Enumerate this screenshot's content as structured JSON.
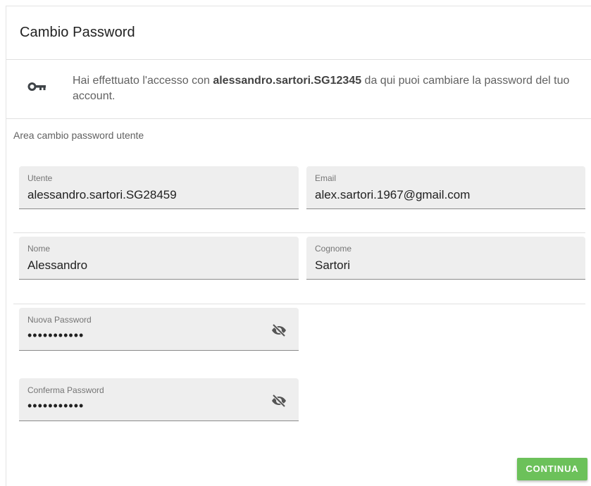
{
  "card": {
    "title": "Cambio Password"
  },
  "info": {
    "icon": "key-icon",
    "text_before": "Hai effettuato l'accesso con ",
    "username": "alessandro.sartori.SG12345",
    "text_after": " da qui puoi cambiare la password del tuo account."
  },
  "section": {
    "label": "Area cambio password utente"
  },
  "fields": {
    "utente": {
      "label": "Utente",
      "value": "alessandro.sartori.SG28459"
    },
    "email": {
      "label": "Email",
      "value": "alex.sartori.1967@gmail.com"
    },
    "nome": {
      "label": "Nome",
      "value": "Alessandro"
    },
    "cognome": {
      "label": "Cognome",
      "value": "Sartori"
    },
    "nuova_password": {
      "label": "Nuova Password",
      "value": "•••••••••••",
      "icon": "eye-off-icon"
    },
    "conferma_password": {
      "label": "Conferma Password",
      "value": "•••••••••••",
      "icon": "eye-off-icon"
    }
  },
  "actions": {
    "continue_label": "CONTINUA"
  },
  "colors": {
    "accent": "#6cc15a",
    "field_bg": "#eeeeee"
  }
}
